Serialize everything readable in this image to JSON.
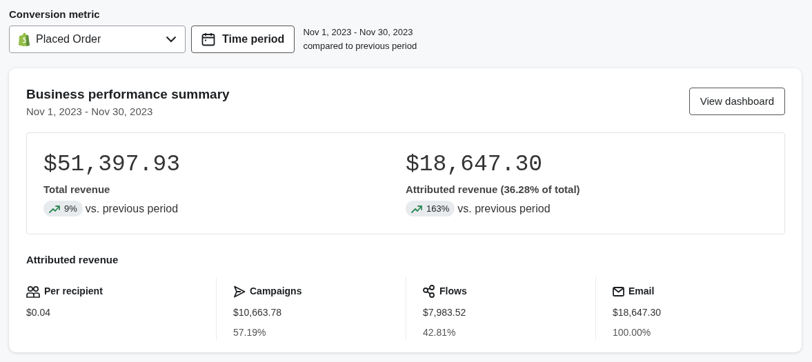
{
  "filter": {
    "label": "Conversion metric",
    "metric": "Placed Order",
    "time_button": "Time period",
    "date_range": "Nov 1, 2023 - Nov 30, 2023",
    "comparison": "compared to previous period"
  },
  "summary": {
    "title": "Business performance summary",
    "date_range": "Nov 1, 2023 - Nov 30, 2023",
    "button": "View dashboard",
    "kpis": [
      {
        "value": "$51,397.93",
        "label": "Total revenue",
        "kind": "up",
        "change": "9%",
        "note": "vs. previous period"
      },
      {
        "value": "$18,647.30",
        "label": "Attributed revenue (36.28% of total)",
        "kind": "up",
        "change": "163%",
        "note": "vs. previous period"
      }
    ],
    "attributed": {
      "title": "Attributed revenue",
      "metrics": [
        {
          "kind": "people",
          "label": "Per recipient",
          "value": "$0.04"
        },
        {
          "kind": "send",
          "label": "Campaigns",
          "value": "$10,663.78",
          "share": "57.19%"
        },
        {
          "kind": "nodes",
          "label": "Flows",
          "value": "$7,983.52",
          "share": "42.81%"
        },
        {
          "kind": "mail",
          "label": "Email",
          "value": "$18,647.30",
          "share": "100.00%"
        }
      ]
    }
  }
}
